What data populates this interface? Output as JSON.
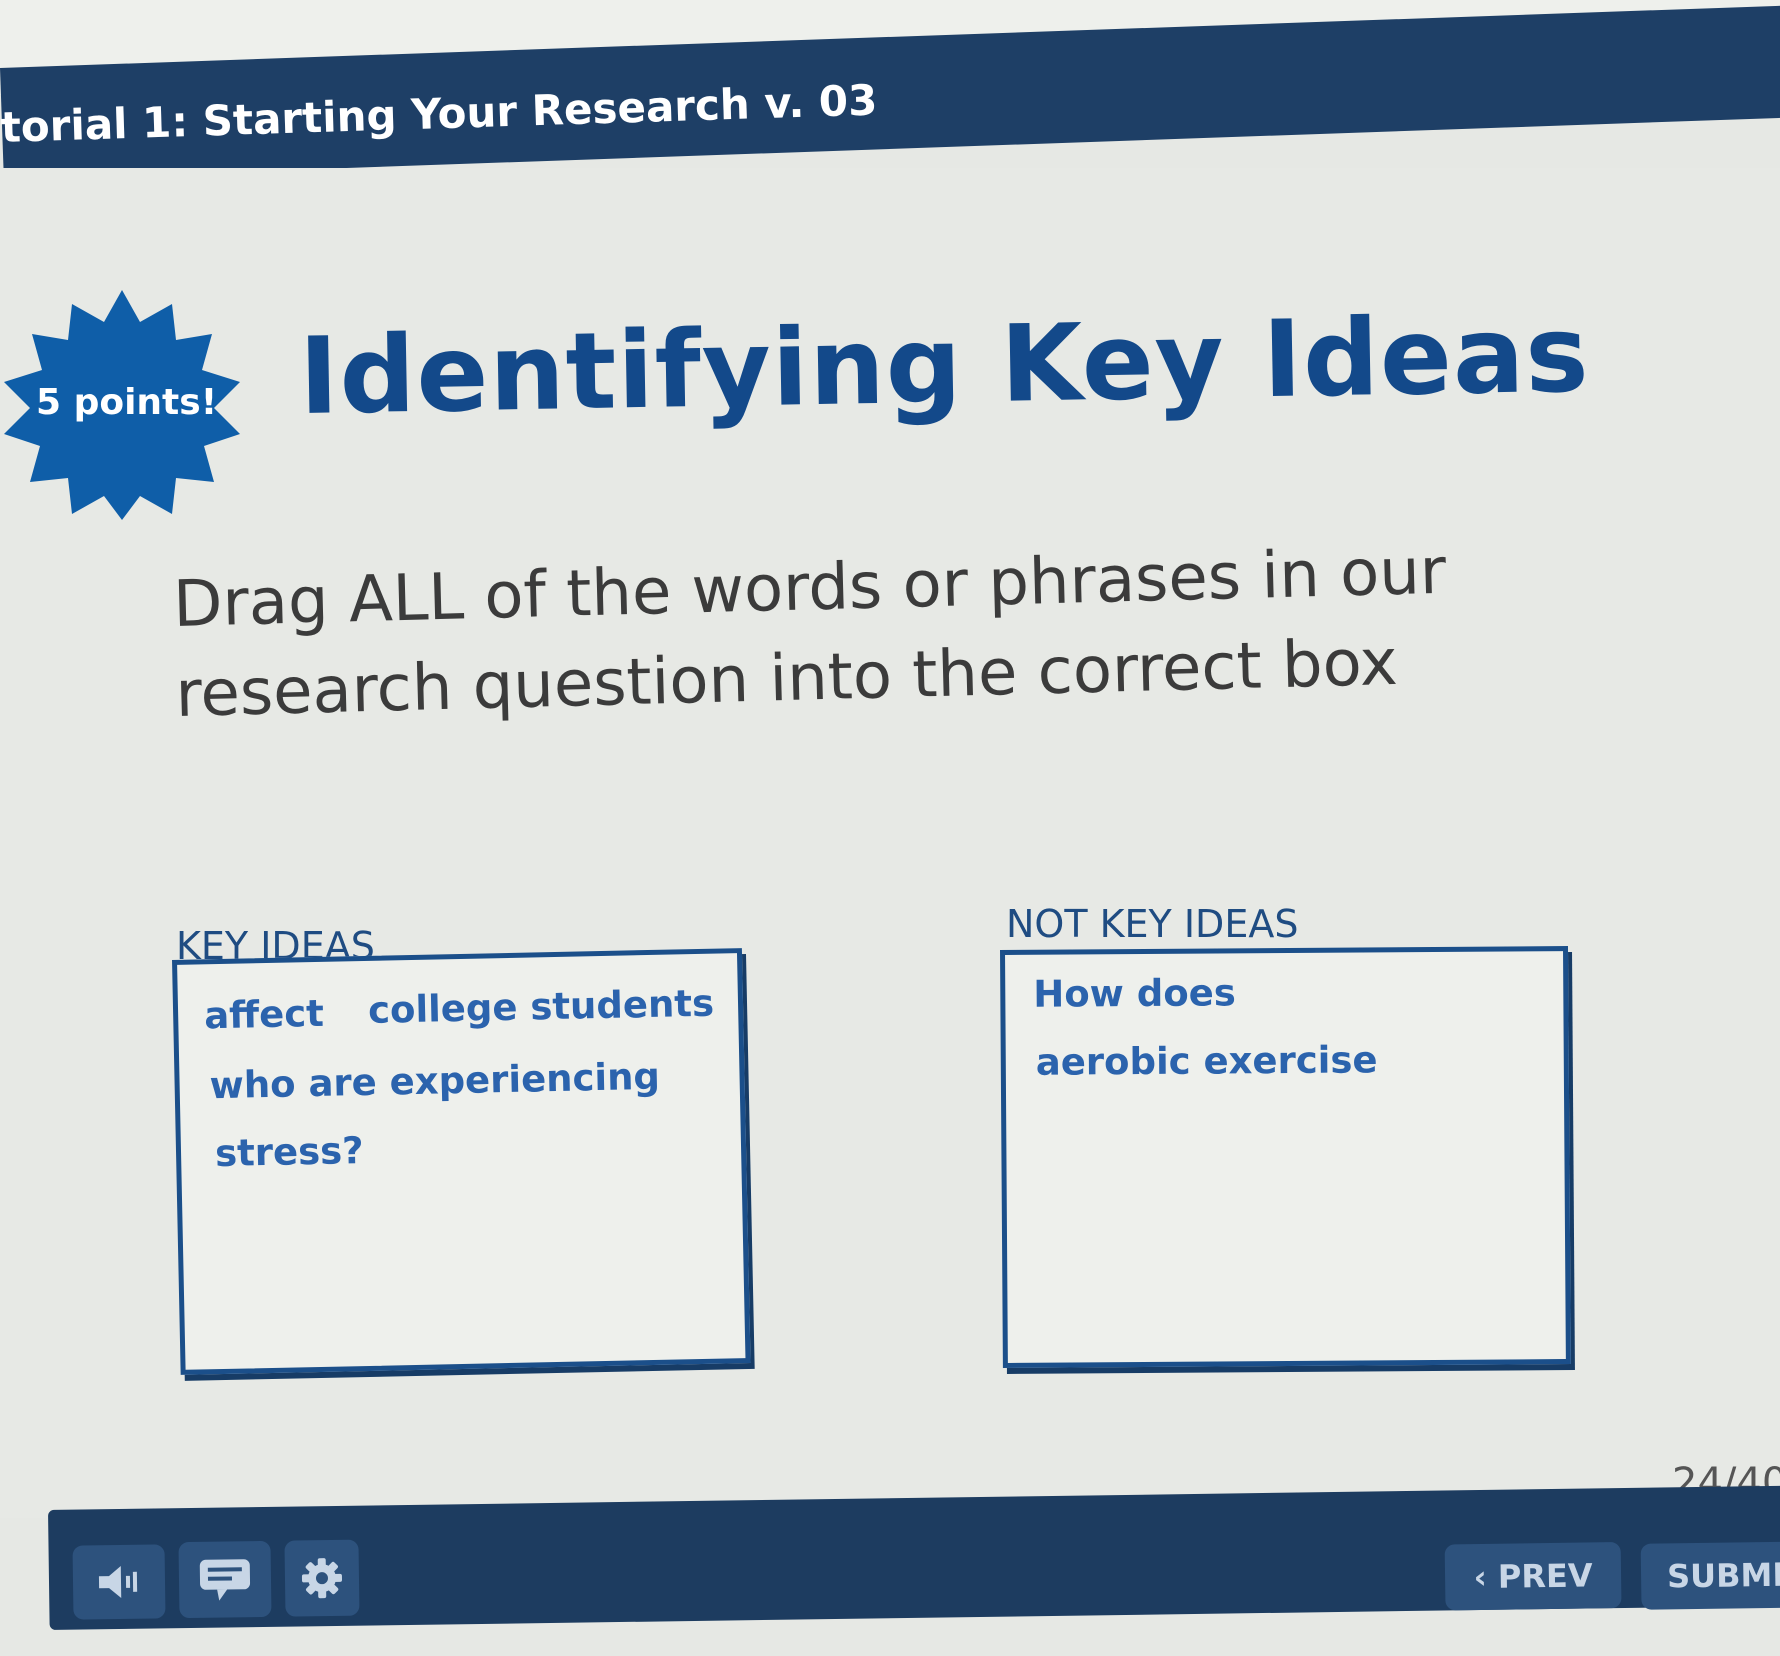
{
  "header": {
    "title": "torial 1: Starting Your Research v. 03"
  },
  "badge": {
    "label": "5 points!"
  },
  "main": {
    "heading": "Identifying Key Ideas",
    "instruction": "Drag ALL of the words or phrases in our research question into the correct box"
  },
  "boxes": {
    "key_ideas": {
      "label": "KEY IDEAS",
      "items": [
        "affect",
        "college students",
        "who are experiencing",
        "stress?"
      ]
    },
    "not_key_ideas": {
      "label": "NOT KEY IDEAS",
      "items": [
        "How does",
        "aerobic exercise"
      ]
    }
  },
  "progress": {
    "page_count": "24/40"
  },
  "footer": {
    "prev_label": "PREV",
    "submit_label": "SUBMI",
    "icons": [
      "speaker-icon",
      "transcript-icon",
      "gear-icon"
    ]
  },
  "colors": {
    "header_bg": "#1e3f66",
    "heading": "#13498a",
    "badge": "#0f5ea8",
    "word": "#2b63ad",
    "box_border": "#1b4f8a"
  }
}
